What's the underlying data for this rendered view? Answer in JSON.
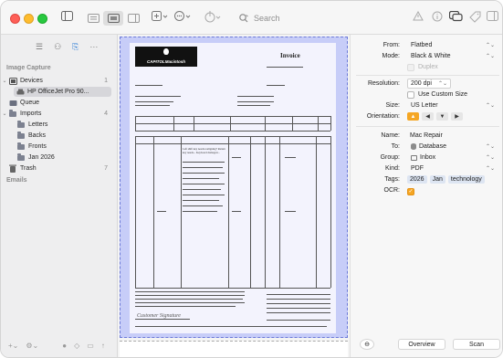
{
  "toolbar": {
    "search_label": "Search",
    "icons": [
      "sidebar-toggle-icon",
      "list-view-icon",
      "grid-view-icon",
      "panel-view-icon",
      "add-icon",
      "more-icon",
      "share-icon",
      "warning-icon",
      "info-icon",
      "chat-icon",
      "tag-icon",
      "inspector-icon"
    ]
  },
  "sidebar": {
    "section_image_capture": "Image Capture",
    "devices": {
      "label": "Devices",
      "count": "1"
    },
    "device_item": "HP OfficeJet Pro 90...",
    "queue": "Queue",
    "imports": {
      "label": "Imports",
      "count": "4"
    },
    "import_items": [
      "Letters",
      "Backs",
      "Fronts",
      "Jan 2026"
    ],
    "trash": {
      "label": "Trash",
      "count": "7"
    },
    "section_emails": "Emails"
  },
  "preview": {
    "logo_text": "CAPITOLMacintosh",
    "invoice_title": "Invoice",
    "item_description": "Left shift key needs realigning? Return key needs... Keyboard damaged...",
    "signature": "Customer Signature"
  },
  "inspector": {
    "from": {
      "label": "From:",
      "value": "Flatbed"
    },
    "mode": {
      "label": "Mode:",
      "value": "Black & White"
    },
    "duplex": "Duplex",
    "resolution": {
      "label": "Resolution:",
      "value": "200 dpi"
    },
    "custom_size": "Use Custom Size",
    "size": {
      "label": "Size:",
      "value": "US Letter"
    },
    "orientation": {
      "label": "Orientation:"
    },
    "name": {
      "label": "Name:",
      "value": "Mac Repair"
    },
    "to": {
      "label": "To:",
      "value": "Database"
    },
    "group": {
      "label": "Group:",
      "value": "Inbox"
    },
    "kind": {
      "label": "Kind:",
      "value": "PDF"
    },
    "tags": {
      "label": "Tags:",
      "values": [
        "2026",
        "Jan",
        "technology"
      ]
    },
    "ocr": {
      "label": "OCR:",
      "checked": true
    },
    "overview_button": "Overview",
    "scan_button": "Scan"
  },
  "colors": {
    "accent": "#f5a623",
    "scan_overlay": "#c7cdf8",
    "selection": "#d6d6da"
  }
}
